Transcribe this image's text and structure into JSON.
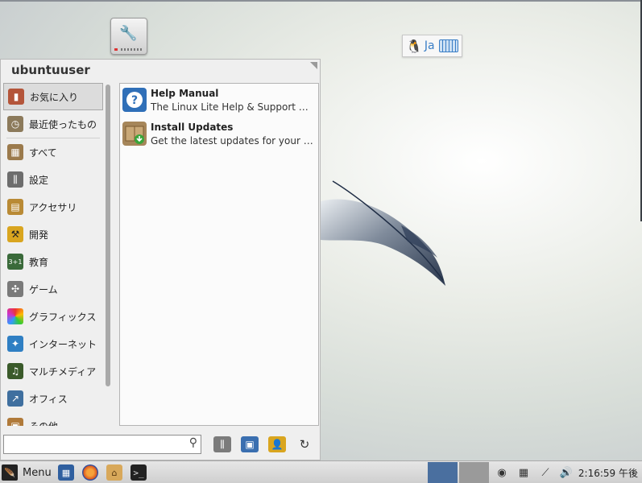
{
  "menu": {
    "username": "ubuntuuser",
    "categories": [
      {
        "label": "お気に入り",
        "icon": "bookmark-icon",
        "color": "#b4553a"
      },
      {
        "label": "最近使ったもの",
        "icon": "clock-icon",
        "color": "#8c7a5b"
      },
      {
        "label": "すべて",
        "icon": "all-apps-icon",
        "color": "#9b7a4c"
      },
      {
        "label": "設定",
        "icon": "settings-sliders-icon",
        "color": "#6d6d6d"
      },
      {
        "label": "アクセサリ",
        "icon": "calculator-icon",
        "color": "#b98a35"
      },
      {
        "label": "開発",
        "icon": "construction-icon",
        "color": "#d9a51f"
      },
      {
        "label": "教育",
        "icon": "chalkboard-icon",
        "color": "#3a6a3a"
      },
      {
        "label": "ゲーム",
        "icon": "gamepad-icon",
        "color": "#7a7a7a"
      },
      {
        "label": "グラフィックス",
        "icon": "color-palette-icon",
        "color": "#d04a9a"
      },
      {
        "label": "インターネット",
        "icon": "globe-icon",
        "color": "#2f7fc3"
      },
      {
        "label": "マルチメディア",
        "icon": "film-music-icon",
        "color": "#3a5a2a"
      },
      {
        "label": "オフィス",
        "icon": "chart-document-icon",
        "color": "#3f6f9f"
      },
      {
        "label": "その他",
        "icon": "misc-icon",
        "color": "#b07a3a"
      }
    ],
    "apps": [
      {
        "title": "Help Manual",
        "desc": "The Linux Lite Help & Support Ma...",
        "icon": "help-icon",
        "color": "#2f6fb8"
      },
      {
        "title": "Install Updates",
        "desc": "Get the latest updates for your co...",
        "icon": "package-update-icon",
        "color": "#a6865a"
      }
    ],
    "search": {
      "value": "",
      "placeholder": ""
    }
  },
  "ime": {
    "lang": "Ja"
  },
  "taskbar": {
    "menu_label": "Menu",
    "clock": "2:16:59 午後"
  }
}
